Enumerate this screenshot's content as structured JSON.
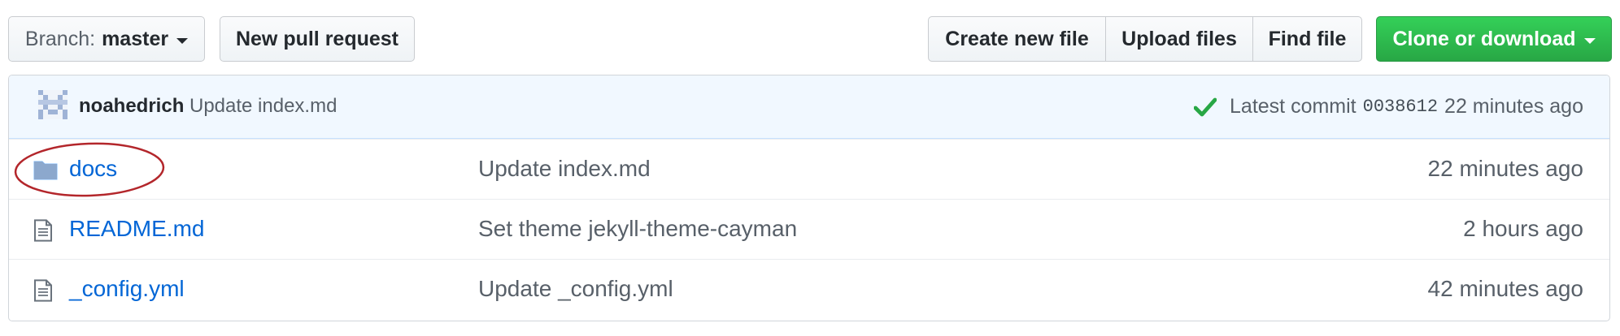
{
  "toolbar": {
    "branch_prefix": "Branch:",
    "branch_name": "master",
    "new_pull_request": "New pull request",
    "create_new_file": "Create new file",
    "upload_files": "Upload files",
    "find_file": "Find file",
    "clone_or_download": "Clone or download"
  },
  "commit": {
    "author": "noahedrich",
    "message": "Update index.md",
    "status_icon": "check-icon",
    "latest_label": "Latest commit",
    "sha": "0038612",
    "age": "22 minutes ago"
  },
  "files": [
    {
      "type": "directory",
      "icon": "folder-icon",
      "name": "docs",
      "message": "Update index.md",
      "age": "22 minutes ago"
    },
    {
      "type": "file",
      "icon": "file-icon",
      "name": "README.md",
      "message": "Set theme jekyll-theme-cayman",
      "age": "2 hours ago"
    },
    {
      "type": "file",
      "icon": "file-icon",
      "name": "_config.yml",
      "message": "Update _config.yml",
      "age": "42 minutes ago"
    }
  ],
  "colors": {
    "link": "#0366d6",
    "primary_green": "#28a745",
    "commit_bar_bg": "#f1f8ff",
    "annotation_red": "#b3262b"
  }
}
